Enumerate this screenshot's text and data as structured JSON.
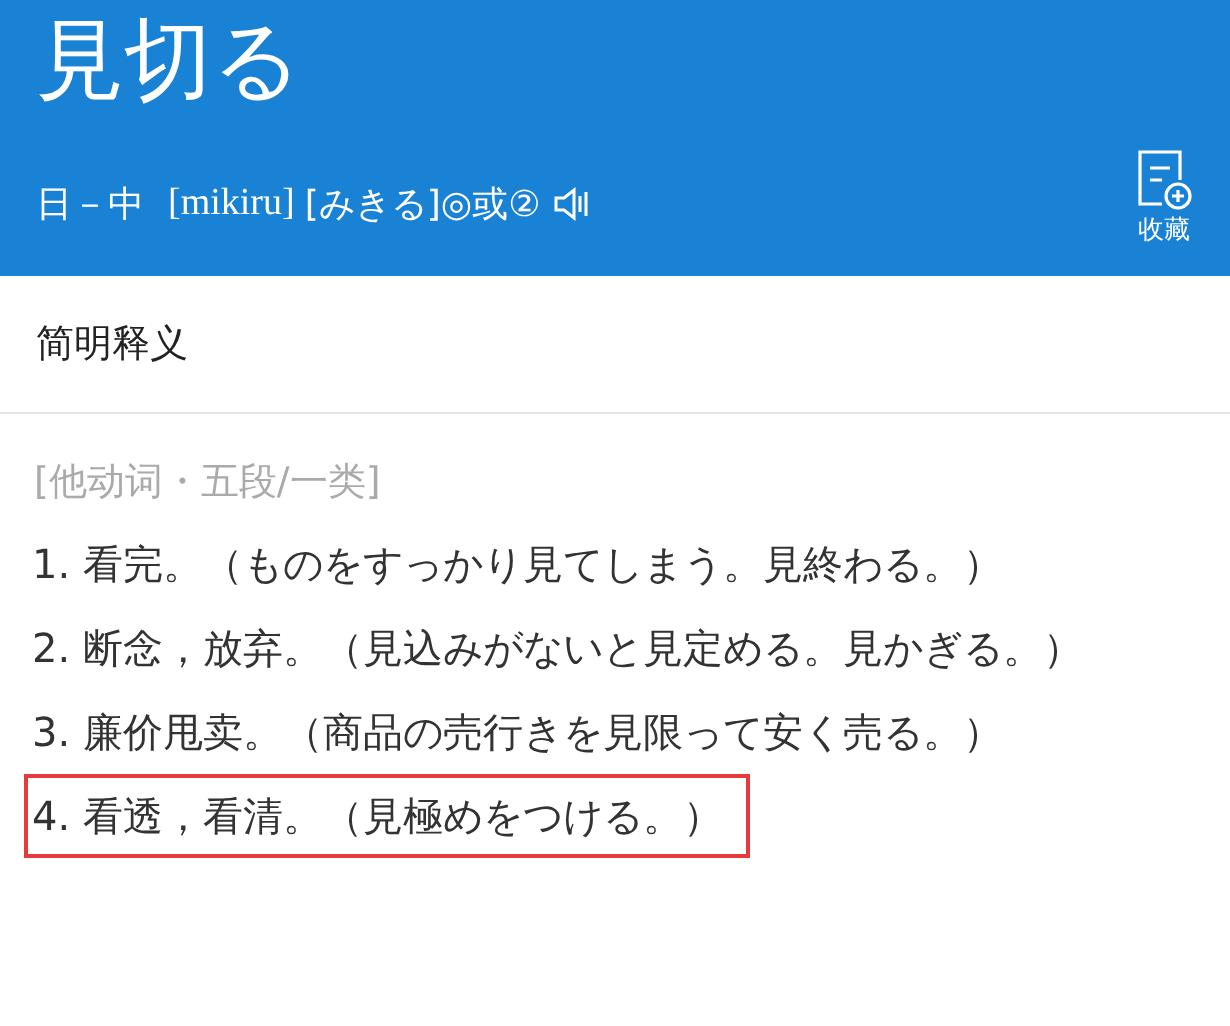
{
  "header": {
    "title": "見切る",
    "direction": "日－中",
    "romaji": "[mikiru]",
    "kana": "[みきる]◎或②",
    "collect_label": "收藏"
  },
  "section": {
    "title": "简明释义"
  },
  "part_of_speech": "[他动词・五段/一类]",
  "definitions": [
    {
      "text": "1. 看完。（ものをすっかり見てしまう。見終わる。）",
      "highlighted": false
    },
    {
      "text": "2. 断念，放弃。（見込みがないと見定める。見かぎる。）",
      "highlighted": false
    },
    {
      "text": "3. 廉价甩卖。（商品の売行きを見限って安く売る。）",
      "highlighted": false
    },
    {
      "text": "4. 看透，看清。（見極めをつける。）",
      "highlighted": true
    }
  ]
}
